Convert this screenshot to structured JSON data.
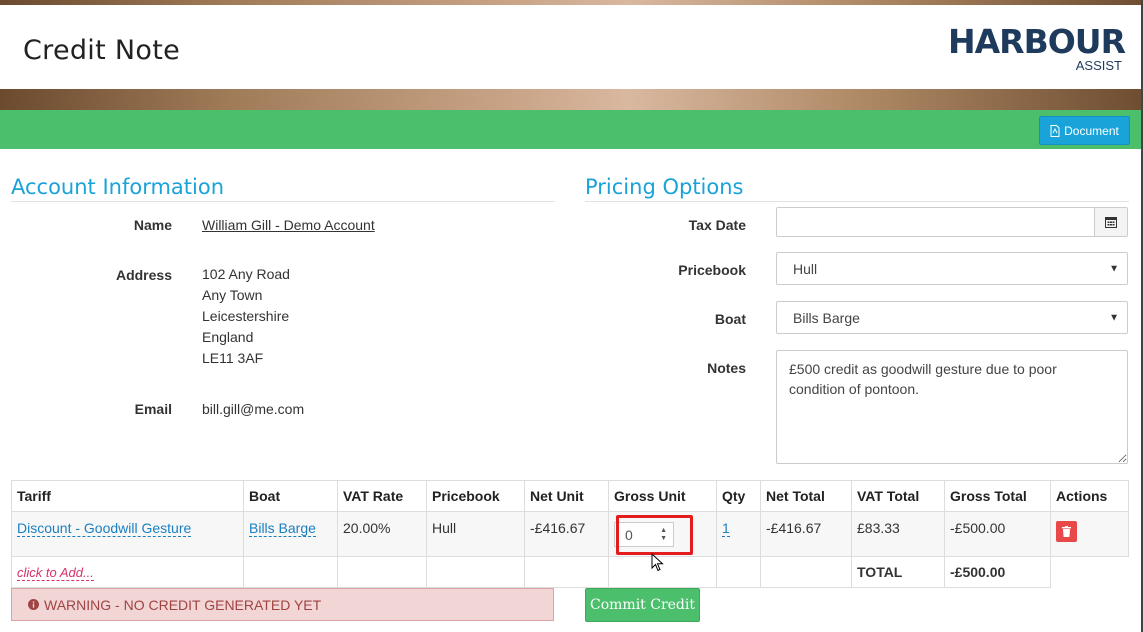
{
  "header": {
    "title": "Credit Note",
    "logo": {
      "brand": "HARBOUR",
      "sub": "ASSIST"
    }
  },
  "toolbar": {
    "document_label": "Document"
  },
  "account": {
    "title": "Account Information",
    "name_label": "Name",
    "name": "William Gill - Demo Account",
    "address_label": "Address",
    "address": [
      "102 Any Road",
      "Any Town",
      "Leicestershire",
      "England",
      "LE11 3AF"
    ],
    "email_label": "Email",
    "email": "bill.gill@me.com"
  },
  "pricing": {
    "title": "Pricing Options",
    "tax_date_label": "Tax Date",
    "tax_date": "",
    "pricebook_label": "Pricebook",
    "pricebook": "Hull",
    "boat_label": "Boat",
    "boat": "Bills Barge",
    "notes_label": "Notes",
    "notes": "£500 credit as goodwill gesture due to poor condition of pontoon."
  },
  "table": {
    "headers": [
      "Tariff",
      "Boat",
      "VAT Rate",
      "Pricebook",
      "Net Unit",
      "Gross Unit",
      "Qty",
      "Net Total",
      "VAT Total",
      "Gross Total",
      "Actions"
    ],
    "row": {
      "tariff": "Discount - Goodwill Gesture",
      "boat": "Bills Barge",
      "vat_rate": "20.00%",
      "pricebook": "Hull",
      "net_unit": "-£416.67",
      "gross_unit": "0",
      "qty": "1",
      "net_total": "-£416.67",
      "vat_total": "£83.33",
      "gross_total": "-£500.00"
    },
    "add_label": "click to Add...",
    "total_label": "TOTAL",
    "total_value": "-£500.00"
  },
  "warning": {
    "text": "WARNING - NO CREDIT GENERATED YET"
  },
  "commit": {
    "label": "Commit Credit"
  },
  "colors": {
    "accent": "#1aa3d9",
    "green": "#4bbf6b",
    "danger": "#e84848",
    "highlight": "#e31d1d"
  }
}
